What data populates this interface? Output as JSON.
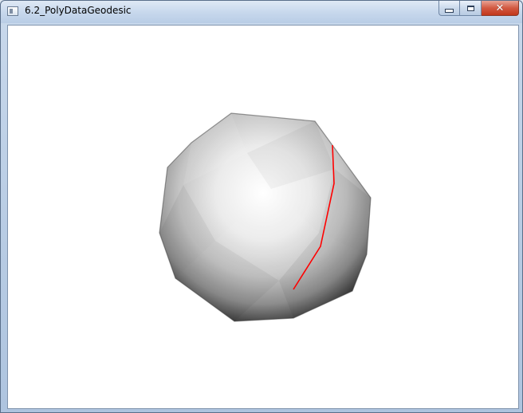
{
  "window": {
    "title": "6.2_PolyDataGeodesic",
    "icons": {
      "app": "window-app-icon",
      "minimize": "minimize-icon",
      "maximize": "maximize-icon",
      "close": "close-icon"
    },
    "colors": {
      "titlebar": "#c6d7ec",
      "close_button": "#c2371c",
      "viewport_background": "#ffffff",
      "geodesic_path": "#ff0000"
    }
  }
}
